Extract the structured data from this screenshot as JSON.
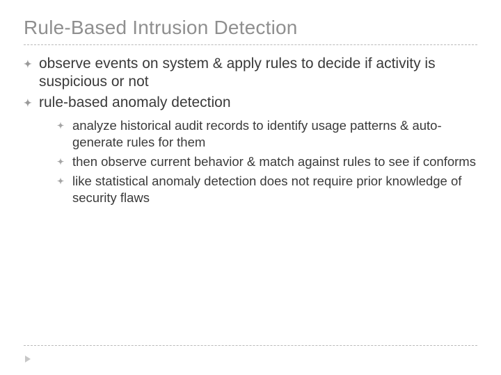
{
  "title": "Rule-Based Intrusion Detection",
  "bullets": [
    {
      "text": "observe events on system & apply rules to decide if activity is suspicious or not"
    },
    {
      "text": "rule-based anomaly detection"
    }
  ],
  "sub_bullets": [
    {
      "text": "analyze historical audit records to identify usage patterns & auto-generate rules for them"
    },
    {
      "text": "then observe current behavior & match against rules to see if conforms"
    },
    {
      "text": "like statistical anomaly detection does not require prior knowledge of security flaws"
    }
  ],
  "bullet_glyph": "✦"
}
